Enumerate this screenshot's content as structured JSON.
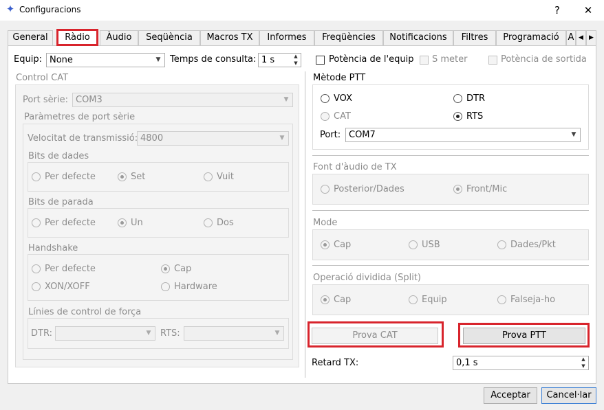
{
  "window": {
    "title": "Configuracions",
    "help": "?",
    "close": "✕"
  },
  "tabs": [
    "General",
    "Ràdio",
    "Àudio",
    "Seqüència",
    "Macros TX",
    "Informes",
    "Freqüències",
    "Notificacions",
    "Filtres",
    "Programació",
    "A"
  ],
  "tab_nav": {
    "left": "◀",
    "right": "▶"
  },
  "top": {
    "equip_label": "Equip:",
    "equip_value": "None",
    "poll_label": "Temps de consulta:",
    "poll_value": "1 s",
    "power_label": "Potència de l'equip",
    "smeter_label": "S meter",
    "out_power_label": "Potència de sortida"
  },
  "cat": {
    "title": "Control CAT",
    "port_label": "Port sèrie:",
    "port_value": "COM3",
    "params_title": "Paràmetres de port sèrie",
    "baud_label": "Velocitat de transmissió:",
    "baud_value": "4800",
    "data_bits": {
      "title": "Bits de dades",
      "options": [
        "Per defecte",
        "Set",
        "Vuit"
      ],
      "selected": 1
    },
    "stop_bits": {
      "title": "Bits de parada",
      "options": [
        "Per defecte",
        "Un",
        "Dos"
      ],
      "selected": 1
    },
    "handshake": {
      "title": "Handshake",
      "options": [
        "Per defecte",
        "Cap",
        "XON/XOFF",
        "Hardware"
      ],
      "selected": 1
    },
    "force": {
      "title": "Línies de control de força",
      "dtr_label": "DTR:",
      "rts_label": "RTS:",
      "dtr_value": "",
      "rts_value": ""
    }
  },
  "ptt": {
    "title": "Mètode PTT",
    "options": [
      "VOX",
      "DTR",
      "CAT",
      "RTS"
    ],
    "selected": 3,
    "port_label": "Port:",
    "port_value": "COM7"
  },
  "audio_src": {
    "title": "Font d'àudio de TX",
    "options": [
      "Posterior/Dades",
      "Front/Mic"
    ],
    "selected": 1
  },
  "mode": {
    "title": "Mode",
    "options": [
      "Cap",
      "USB",
      "Dades/Pkt"
    ],
    "selected": 0
  },
  "split": {
    "title": "Operació dividida (Split)",
    "options": [
      "Cap",
      "Equip",
      "Falseja-ho"
    ],
    "selected": 0
  },
  "buttons": {
    "test_cat": "Prova CAT",
    "test_ptt": "Prova PTT",
    "ok": "Acceptar",
    "cancel": "Cancel·lar"
  },
  "tx_delay": {
    "label": "Retard TX:",
    "value": "0,1 s"
  },
  "colors": {
    "highlight": "#d8242c"
  }
}
